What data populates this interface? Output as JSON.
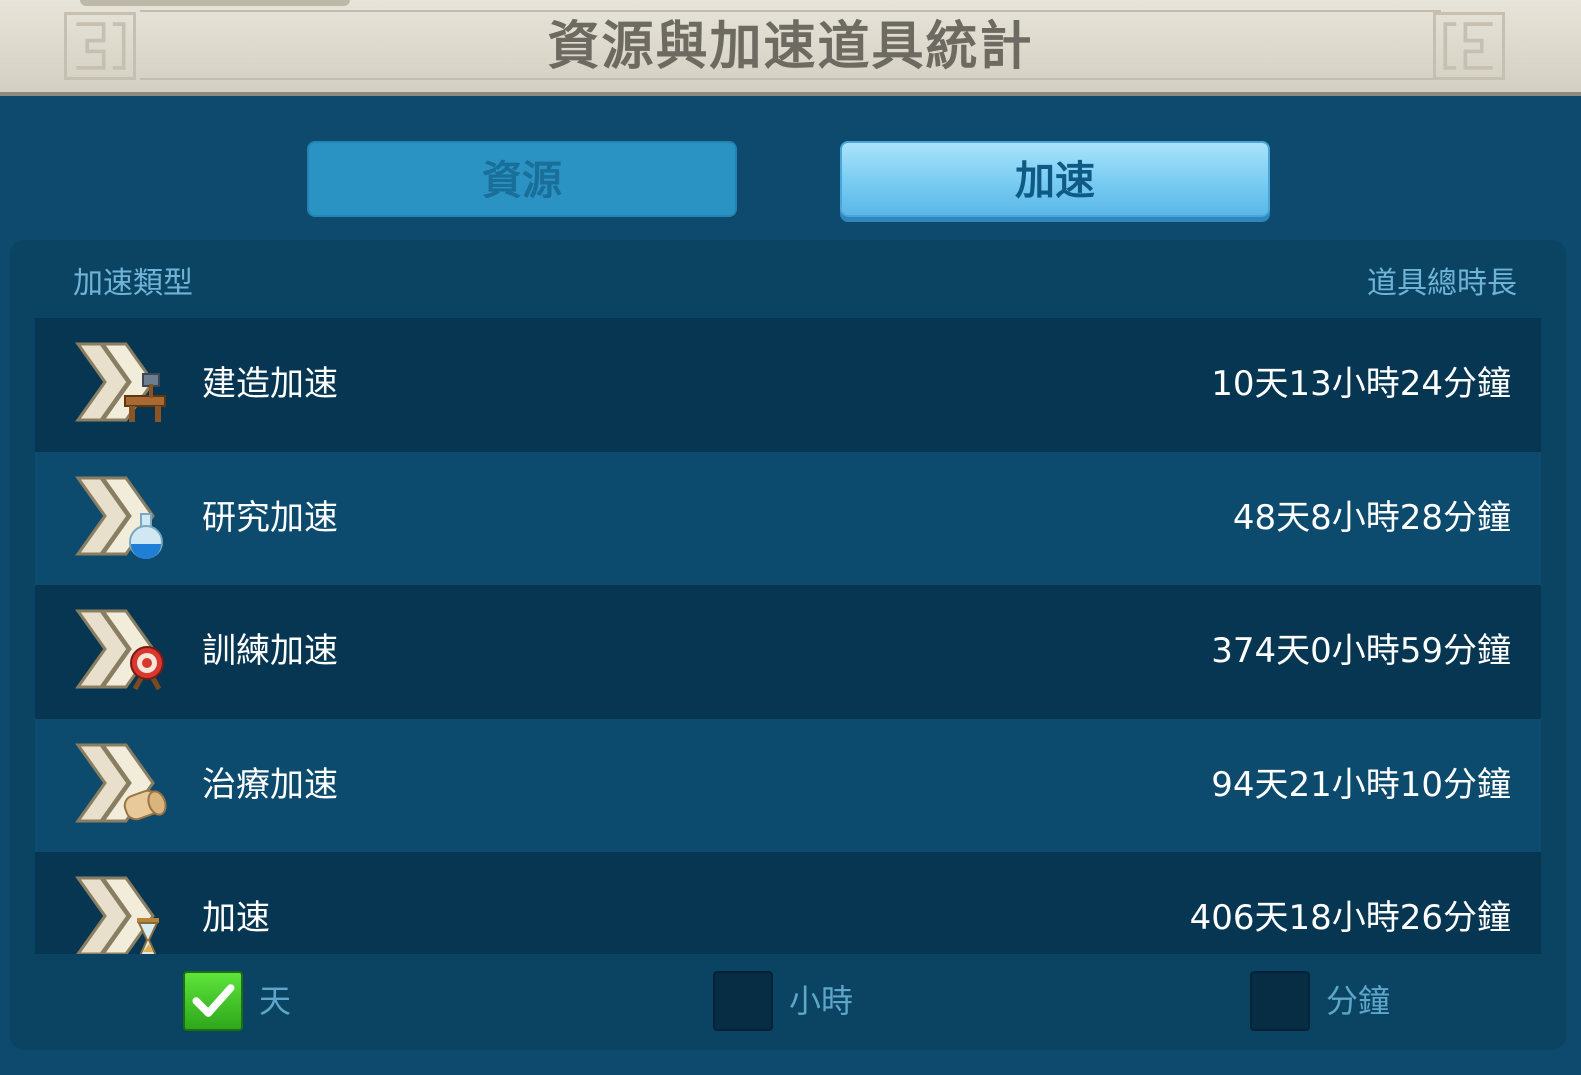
{
  "title": "資源與加速道具統計",
  "tabs": [
    {
      "label": "資源",
      "active": false
    },
    {
      "label": "加速",
      "active": true
    }
  ],
  "columns": {
    "type_header": "加速類型",
    "duration_header": "道具總時長"
  },
  "rows": [
    {
      "label": "建造加速",
      "value": "10天13小時24分鐘",
      "icon": "construction-speedup-icon"
    },
    {
      "label": "研究加速",
      "value": "48天8小時28分鐘",
      "icon": "research-speedup-icon"
    },
    {
      "label": "訓練加速",
      "value": "374天0小時59分鐘",
      "icon": "training-speedup-icon"
    },
    {
      "label": "治療加速",
      "value": "94天21小時10分鐘",
      "icon": "healing-speedup-icon"
    },
    {
      "label": "加速",
      "value": "406天18小時26分鐘",
      "icon": "universal-speedup-icon"
    }
  ],
  "units": [
    {
      "label": "天",
      "checked": true
    },
    {
      "label": "小時",
      "checked": false
    },
    {
      "label": "分鐘",
      "checked": false
    }
  ],
  "colors": {
    "background": "#0d4a6e",
    "active_tab": "#74c9f1",
    "checkbox_checked": "#3cbf24"
  }
}
